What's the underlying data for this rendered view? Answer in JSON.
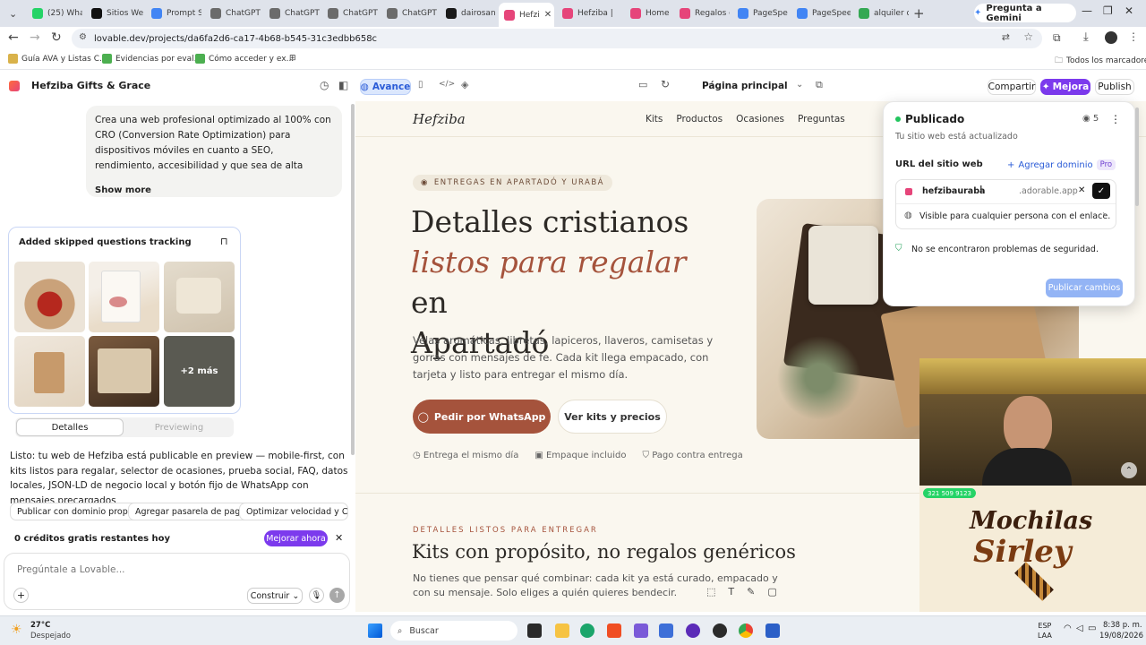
{
  "browser": {
    "tabs": [
      {
        "label": "(25) Wha",
        "color": "#25d366"
      },
      {
        "label": "Sitios We",
        "color": "#111111"
      },
      {
        "label": "Prompt S",
        "color": "#4285f4"
      },
      {
        "label": "ChatGPT",
        "color": "#6b6b6b"
      },
      {
        "label": "ChatGPT",
        "color": "#6b6b6b"
      },
      {
        "label": "ChatGPT",
        "color": "#6b6b6b"
      },
      {
        "label": "ChatGPT",
        "color": "#6b6b6b"
      },
      {
        "label": "dairosan",
        "color": "#1a1a1a"
      },
      {
        "label": "Hefzi",
        "color": "#e6457a"
      },
      {
        "label": "Hefziba |",
        "color": "#e6457a"
      },
      {
        "label": "Home | Lo",
        "color": "#e6457a"
      },
      {
        "label": "Regalos c",
        "color": "#e6457a"
      },
      {
        "label": "PageSpee",
        "color": "#4285f4"
      },
      {
        "label": "PageSpee",
        "color": "#4285f4"
      },
      {
        "label": "alquiler d",
        "color": "#34a853"
      }
    ],
    "gemini_label": "Pregunta a Gemini",
    "url": "lovable.dev/projects/da6fa2d6-ca17-4b68-b545-31c3edbb658c",
    "bookmarks": [
      "Guía AVA y Listas C...",
      "Evidencias por eval...",
      "Cómo acceder y ex..."
    ],
    "all_bookmarks": "Todos los marcadores"
  },
  "app": {
    "project_name": "Hefziba Gifts & Grace",
    "mode_label": "Avance",
    "page_label": "Página principal",
    "share_label": "Compartir",
    "upgrade_label": "Mejora",
    "publish_label": "Publish"
  },
  "chat": {
    "prompt_text": "Crea una web profesional optimizado al 100% con CRO (Conversion Rate Optimization) para dispositivos móviles en cuanto a SEO, rendimiento, accesibilidad y que sea de alta conversión para la empresa de: productos con...",
    "show_more": "Show more",
    "card_title": "Added skipped questions tracking",
    "more_images": "+2 más",
    "details_tab": "Detalles",
    "previewing_tab": "Previewing",
    "message": "Listo: tu web de Hefziba está publicable en preview — mobile-first, con kits listos para regalar, selector de ocasiones, prueba social, FAQ, datos locales, JSON-LD de negocio local y botón fijo de WhatsApp con mensajes precargados",
    "suggestions": [
      "Publicar con dominio propio",
      "Agregar pasarela de pago",
      "Optimizar velocidad y Core"
    ],
    "credits_text": "0 créditos gratis restantes hoy",
    "upgrade_now": "Mejorar ahora",
    "input_placeholder": "Pregúntale a Lovable...",
    "build_label": "Construir"
  },
  "site": {
    "brand": "Hefziba",
    "nav": [
      "Kits",
      "Productos",
      "Ocasiones",
      "Preguntas"
    ],
    "badge": "ENTREGAS EN APARTADÓ Y URABÁ",
    "hero_line1": "Detalles cristianos",
    "hero_italic": "listos para regalar",
    "hero_en": "en",
    "hero_line3": "Apartadó",
    "hero_desc": "Velas aromáticas, libretas, lapiceros, llaveros, camisetas y gorras con mensajes de fe. Cada kit llega empacado, con tarjeta y listo para entregar el mismo día.",
    "cta_primary": "Pedir por WhatsApp",
    "cta_secondary": "Ver kits y precios",
    "features": [
      "Entrega el mismo día",
      "Empaque incluido",
      "Pago contra entrega"
    ],
    "section_kicker": "DETALLES LISTOS PARA ENTREGAR",
    "section_title": "Kits con propósito, no regalos genéricos",
    "section_desc": "No tienes que pensar qué combinar: cada kit ya está curado, empacado y con su mensaje. Solo eliges a quién quieres bendecir."
  },
  "publish_panel": {
    "status": "Publicado",
    "visitors": "5",
    "subtitle": "Tu sitio web está actualizado",
    "url_label": "URL del sitio web",
    "add_domain": "Agregar dominio",
    "pro_badge": "Pro",
    "subdomain_value": "hefzibauraba",
    "domain_suffix": ".adorable.app",
    "visibility": "Visible para cualquier persona con el enlace.",
    "security": "No se encontraron problemas de seguridad.",
    "publish_changes": "Publicar cambios"
  },
  "overlay": {
    "phone_label": "321 509 9123",
    "ad_line1": "Mochilas",
    "ad_line2": "Sirley"
  },
  "taskbar": {
    "temperature": "27°C",
    "weather": "Despejado",
    "search": "Buscar",
    "lang1": "ESP",
    "lang2": "LAA",
    "time": "8:38 p. m.",
    "date": "19/08/2026"
  },
  "colors": {
    "accent_purple": "#7c3aed",
    "terracotta": "#a5533c",
    "publish_blue": "#93b4f5",
    "cream_bg": "#faf7ef"
  }
}
